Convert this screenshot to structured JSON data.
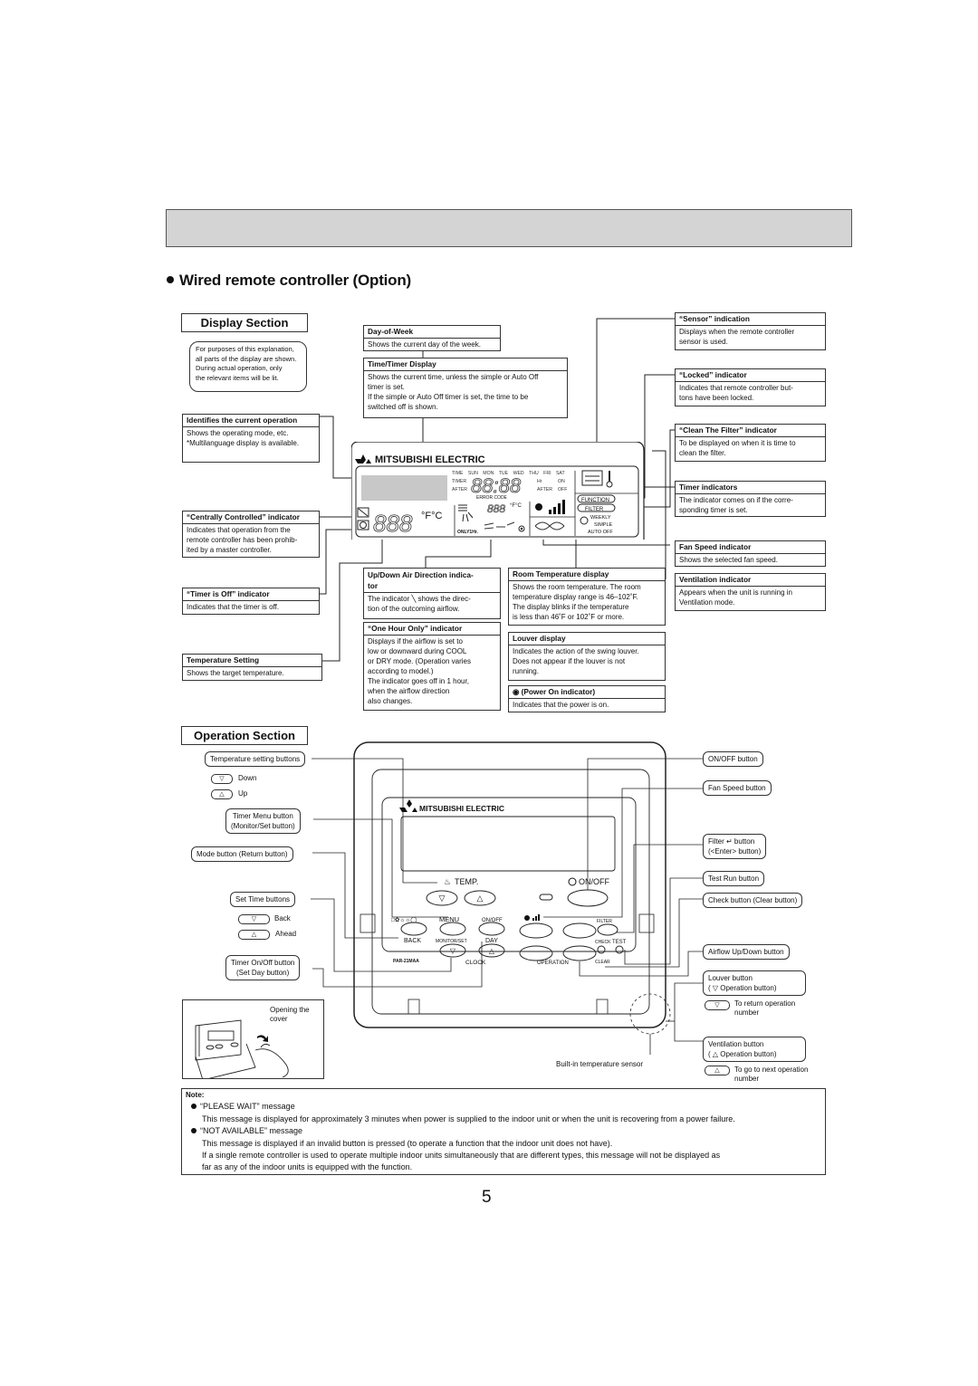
{
  "header": {
    "heading": "Wired remote controller (Option)"
  },
  "display_section": {
    "title": "Display Section",
    "intro_note": [
      "For purposes of this explanation,",
      "all parts of the display are shown.",
      "During actual operation, only",
      "the relevant items will be lit."
    ],
    "callouts": {
      "day_of_week": {
        "title": "Day-of-Week",
        "body": "Shows the current day of the week."
      },
      "time_timer": {
        "title": "Time/Timer Display",
        "body": [
          "Shows the current time, unless the simple or Auto Off",
          "timer is set.",
          "If the simple or Auto Off timer is set, the time to be",
          "switched off is shown."
        ]
      },
      "current_operation": {
        "title": "Identifies the current operation",
        "body": [
          " Shows the operating mode, etc.",
          "*Multilanguage display is available."
        ]
      },
      "centrally_controlled": {
        "title": "“Centrally Controlled” indicator",
        "body": [
          "Indicates that operation from the",
          "remote controller has been prohib-",
          "ited by a master controller."
        ]
      },
      "timer_off": {
        "title": "“Timer is Off” indicator",
        "body": "Indicates that the timer is off."
      },
      "temperature_setting": {
        "title": "Temperature Setting",
        "body": "Shows the target temperature."
      },
      "air_direction": {
        "title": [
          "Up/Down Air Direction indica-",
          "tor"
        ],
        "body": [
          "The indicator ╲ shows the direc-",
          "tion of the outcoming airflow."
        ]
      },
      "one_hour_only": {
        "title": "“One Hour Only” indicator",
        "body": [
          "Displays if the airflow is set to",
          "low or downward during COOL",
          "or DRY mode. (Operation varies",
          "according to model.)",
          "The indicator goes off in 1 hour,",
          "when the airflow direction",
          "also changes."
        ]
      },
      "room_temperature": {
        "title": "Room Temperature display",
        "body": [
          "Shows the room temperature. The room",
          "temperature display range is 46–102˚F.",
          "The display blinks if the temperature",
          "is less than 46˚F or 102˚F or more."
        ]
      },
      "louver_display": {
        "title": "Louver display",
        "body": [
          "Indicates the action of the swing louver.",
          "Does not appear if the louver is not",
          "running."
        ]
      },
      "power_on": {
        "title": "(Power On indicator)",
        "body": "Indicates that the power is on."
      },
      "sensor": {
        "title": "“Sensor” indication",
        "body": [
          "Displays when the remote controller",
          "sensor is used."
        ]
      },
      "locked": {
        "title": "“Locked” indicator",
        "body": [
          "Indicates that remote controller but-",
          "tons have been locked."
        ]
      },
      "clean_filter": {
        "title": "“Clean The Filter” indicator",
        "body": [
          "To be displayed on when it is time to",
          "clean the filter."
        ]
      },
      "timer_indicators": {
        "title": "Timer indicators",
        "body": [
          "The indicator comes on if the corre-",
          "sponding timer is set."
        ]
      },
      "fan_speed": {
        "title": "Fan Speed indicator",
        "body": "Shows the selected fan speed."
      },
      "ventilation": {
        "title": "Ventilation indicator",
        "body": [
          "Appears when the unit is running in",
          "Ventilation mode."
        ]
      }
    },
    "lcd": {
      "brand": "MITSUBISHI ELECTRIC",
      "days": [
        "TIME",
        "SUN",
        "MON",
        "TUE",
        "WED",
        "THU",
        "FRI",
        "SAT"
      ],
      "timer_label": "TIMER",
      "after_label": "AFTER",
      "hr_label": "Hr",
      "on_label": "ON",
      "after_right": "AFTER",
      "off_label": "OFF",
      "time_digits": "88:88",
      "error_code": "ERROR CODE",
      "temp_digits": "888",
      "temp_unit": "°F°C",
      "small_unit": "°F°C",
      "only1hr": "ONLY1Hr.",
      "function_label": "FUNCTION",
      "filter_label": "FILTER",
      "weekly": "WEEKLY",
      "simple": "SIMPLE",
      "auto_off": "AUTO OFF"
    }
  },
  "operation_section": {
    "title": "Operation Section",
    "left_labels": {
      "temp_buttons": "Temperature setting buttons",
      "down": "Down",
      "up": "Up",
      "timer_menu": [
        "Timer Menu button",
        "(Monitor/Set button)"
      ],
      "mode": "Mode button (Return button)",
      "set_time": "Set Time buttons",
      "back": "Back",
      "ahead": "Ahead",
      "timer_onoff": [
        "Timer On/Off button",
        "(Set Day button)"
      ],
      "opening_cover": [
        "Opening the",
        "cover"
      ]
    },
    "right_labels": {
      "onoff": "ON/OFF button",
      "fan_speed": "Fan Speed button",
      "filter": [
        "Filter ↵ button",
        "(<Enter> button)"
      ],
      "test_run": "Test Run button",
      "check": "Check button (Clear button)",
      "airflow": "Airflow Up/Down button",
      "louver": [
        "Louver button",
        "( ▽ Operation button)"
      ],
      "return_op": [
        "To return operation",
        "number"
      ],
      "ventilation": [
        "Ventilation button",
        "( △ Operation button)"
      ],
      "next_op": [
        "To go to next operation",
        "number"
      ],
      "sensor": "Built-in temperature sensor"
    },
    "controller": {
      "brand": "MITSUBISHI ELECTRIC",
      "temp": "TEMP.",
      "onoff": "ON/OFF",
      "menu": "MENU",
      "timer_onoff": "ON/OFF",
      "back": "BACK",
      "monitor_set": "MONITOR/SET",
      "day": "DAY",
      "clock": "CLOCK",
      "model": "PAR-21MAA",
      "operation": "OPERATION",
      "filter": "FILTER",
      "check": "CHECK",
      "test": "TEST",
      "clear": "CLEAR"
    }
  },
  "note": {
    "title": "Note:",
    "items": [
      {
        "heading": "“PLEASE WAIT” message",
        "lines": [
          "This message is displayed for approximately 3 minutes when power is supplied to the indoor unit or when the unit is recovering from a power failure."
        ]
      },
      {
        "heading": "“NOT AVAILABLE” message",
        "lines": [
          "This message is displayed if an invalid button is pressed (to operate a function that the indoor unit does not have).",
          "If a single remote controller is used to operate multiple indoor units simultaneously that are different types, this message will not be displayed as",
          "far as any of the indoor units is equipped with the function."
        ]
      }
    ]
  },
  "page_number": "5"
}
